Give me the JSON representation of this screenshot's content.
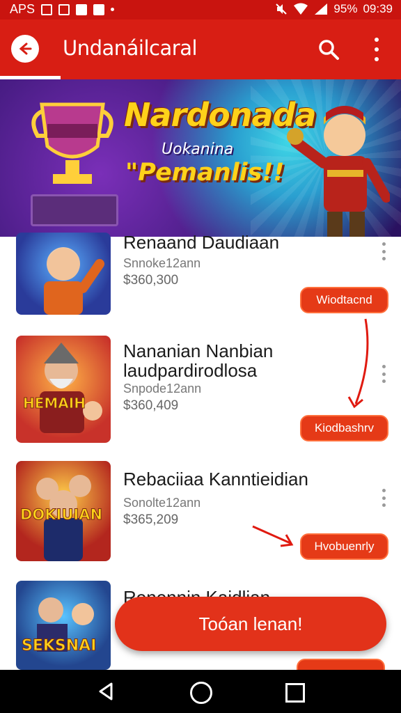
{
  "status_bar": {
    "carrier_text": "APS",
    "battery": "95%",
    "time": "09:39",
    "icons": [
      "notification-icon",
      "app-icon",
      "app-icon",
      "app-icon",
      "dot-icon",
      "mute-icon",
      "wifi-icon",
      "signal-icon"
    ]
  },
  "app_bar": {
    "title": "Undanáilcaral",
    "back_icon": "back-arrow-icon",
    "search_icon": "search-icon",
    "more_icon": "more-vert-icon"
  },
  "banner": {
    "title": "Nardonada",
    "subtitle": "Uokanina",
    "tagline": "\"Pemanlis!!"
  },
  "games": [
    {
      "title": "Renaand Daudiaan",
      "subtitle": "Snnoke12ann",
      "price": "$360,300",
      "action": "Wiodtacnd"
    },
    {
      "title": "Nananian Nanbian laudpardirodlosa",
      "subtitle": "Snpode12ann",
      "price": "$360,409",
      "action": "Kiodbashrv"
    },
    {
      "title": "Rebaciiaa Kanntieidian",
      "subtitle": "Sonolte12ann",
      "price": "$365,209",
      "action": "Hvobuenrly"
    },
    {
      "title": "Renennin Kaidlian",
      "subtitle": "",
      "price": "",
      "action": ""
    }
  ],
  "fab_label": "Toóan lenan!",
  "nav_bar": {
    "back_icon": "nav-back-icon",
    "home_icon": "nav-home-icon",
    "recent_icon": "nav-recent-icon"
  },
  "colors": {
    "primary": "#d81e14",
    "status_bar": "#c9140f",
    "action": "#e53a17",
    "fab": "#e2321a"
  }
}
